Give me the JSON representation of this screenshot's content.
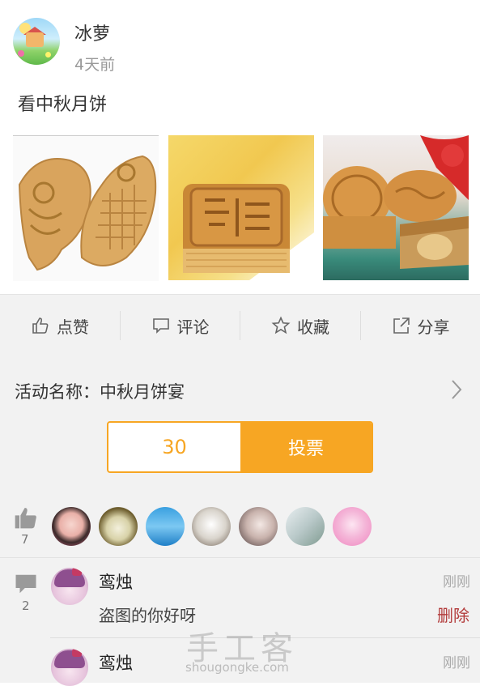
{
  "post": {
    "username": "冰萝",
    "time": "4天前",
    "text": "看中秋月饼"
  },
  "actions": [
    {
      "label": "点赞",
      "icon": "thumbs-up-icon"
    },
    {
      "label": "评论",
      "icon": "comment-icon"
    },
    {
      "label": "收藏",
      "icon": "star-icon"
    },
    {
      "label": "分享",
      "icon": "share-icon"
    }
  ],
  "activity": {
    "label": "活动名称：中秋月饼宴",
    "vote_count": "30",
    "vote_button": "投票"
  },
  "likes": {
    "count": "7"
  },
  "comments": {
    "count": "2",
    "items": [
      {
        "name": "鸾烛",
        "time": "刚刚",
        "text": "盗图的你好呀",
        "delete_label": "删除"
      },
      {
        "name": "鸾烛",
        "time": "刚刚"
      }
    ]
  },
  "watermark": {
    "title": "手工客",
    "url": "shougongke.com"
  },
  "colors": {
    "accent": "#f7a623",
    "background": "#f2f2f2",
    "delete": "#b23a3a"
  }
}
